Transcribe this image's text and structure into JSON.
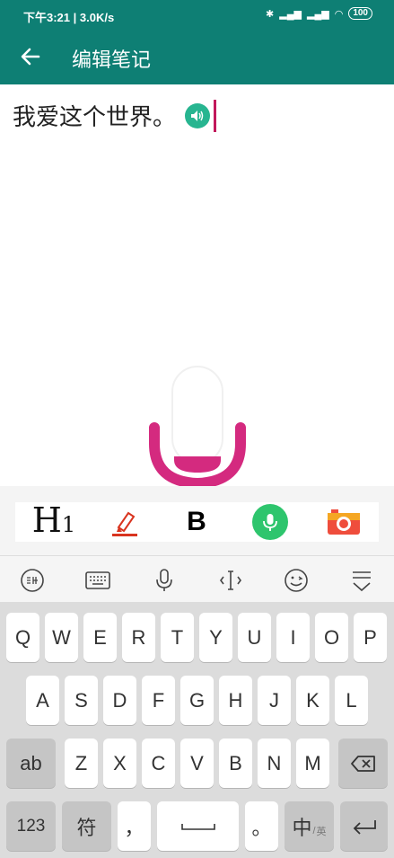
{
  "status_bar": {
    "time_speed": "下午3:21 | 3.0K/s",
    "battery": "100"
  },
  "app_bar": {
    "title": "编辑笔记"
  },
  "editor": {
    "note_text": "我爱这个世界。"
  },
  "format_toolbar": {
    "heading_label": "H",
    "heading_level": "1",
    "bold_label": "B"
  },
  "keyboard": {
    "rows": [
      [
        "Q",
        "W",
        "E",
        "R",
        "T",
        "Y",
        "U",
        "I",
        "O",
        "P"
      ],
      [
        "A",
        "S",
        "D",
        "F",
        "G",
        "H",
        "J",
        "K",
        "L"
      ],
      [
        "Z",
        "X",
        "C",
        "V",
        "B",
        "N",
        "M"
      ]
    ],
    "shift_label": "ab",
    "numbers_label": "123",
    "symbols_label": "符",
    "comma_label": "，",
    "period_label": "。",
    "lang_label": "中",
    "lang_sub_label": "英"
  },
  "colors": {
    "app_bar": "#0e7f74",
    "mic_accent": "#d42a7f",
    "speaker": "#27b590",
    "voice_button": "#2ec56d"
  }
}
